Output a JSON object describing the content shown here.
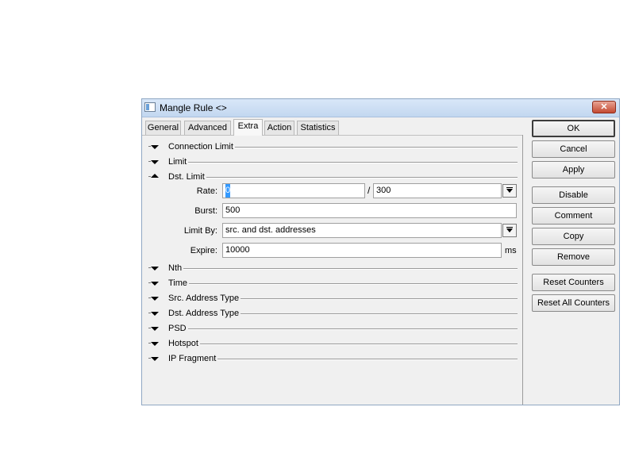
{
  "window": {
    "title": "Mangle Rule <>",
    "close_label": "✕"
  },
  "tabs": [
    {
      "label": "General",
      "active": false
    },
    {
      "label": "Advanced",
      "active": false
    },
    {
      "label": "Extra",
      "active": true
    },
    {
      "label": "Action",
      "active": false
    },
    {
      "label": "Statistics",
      "active": false
    }
  ],
  "sections": {
    "connection_limit": "Connection Limit",
    "limit": "Limit",
    "dst_limit": "Dst. Limit",
    "nth": "Nth",
    "time": "Time",
    "src_address_type": "Src. Address Type",
    "dst_address_type": "Dst. Address Type",
    "psd": "PSD",
    "hotspot": "Hotspot",
    "ip_fragment": "IP Fragment"
  },
  "dst_limit": {
    "rate_label": "Rate:",
    "rate_value": "0",
    "rate_separator": "/",
    "rate_unit_value": "300",
    "burst_label": "Burst:",
    "burst_value": "500",
    "limit_by_label": "Limit By:",
    "limit_by_value": "src. and dst. addresses",
    "expire_label": "Expire:",
    "expire_value": "10000",
    "expire_unit": "ms"
  },
  "buttons": {
    "ok": "OK",
    "cancel": "Cancel",
    "apply": "Apply",
    "disable": "Disable",
    "comment": "Comment",
    "copy": "Copy",
    "remove": "Remove",
    "reset_counters": "Reset Counters",
    "reset_all_counters": "Reset All Counters"
  },
  "icons": {
    "window": "window-icon",
    "close": "close-icon",
    "expand": "chevron-down-icon",
    "collapse": "chevron-up-icon",
    "dropdown": "dropdown-arrow-icon"
  }
}
